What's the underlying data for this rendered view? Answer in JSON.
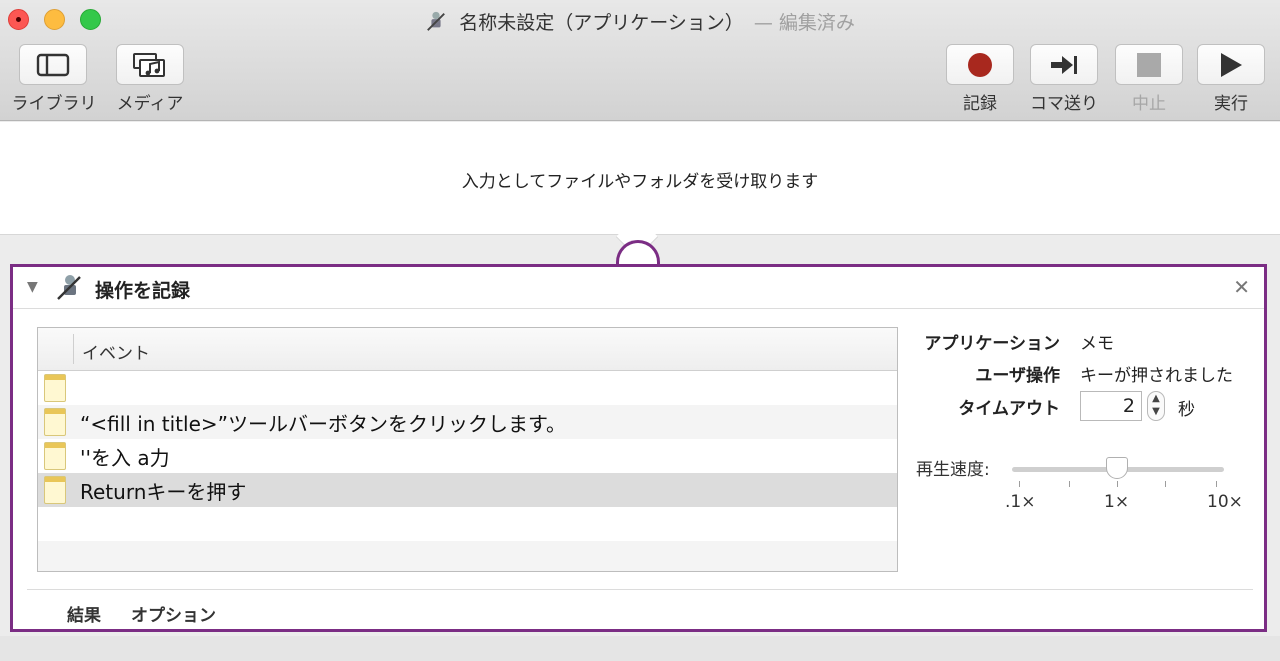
{
  "window": {
    "title": "名称未設定（アプリケーション）",
    "edited_label": "— 編集済み"
  },
  "toolbar": {
    "library_label": "ライブラリ",
    "media_label": "メディア",
    "record_label": "記録",
    "step_label": "コマ送り",
    "stop_label": "中止",
    "run_label": "実行"
  },
  "input_area": {
    "text": "入力としてファイルやフォルダを受け取ります"
  },
  "action": {
    "title": "操作を記録",
    "events_header": "イベント",
    "events": [
      {
        "text": ""
      },
      {
        "text": "“<fill in title>”ツールバーボタンをクリックします。"
      },
      {
        "text": "''を入 a力"
      },
      {
        "text": "Returnキーを押す"
      }
    ],
    "properties": {
      "application_label": "アプリケーション",
      "application_value": "メモ",
      "user_action_label": "ユーザ操作",
      "user_action_value": "キーが押されました",
      "timeout_label": "タイムアウト",
      "timeout_value": "2",
      "timeout_unit": "秒",
      "speed_label": "再生速度:",
      "speed_min": ".1×",
      "speed_mid": "1×",
      "speed_max": "10×",
      "speed_value": "1×"
    },
    "footer": {
      "results_tab": "結果",
      "options_tab": "オプション"
    }
  },
  "colors": {
    "accent": "#7b2d84",
    "record": "#a8281e"
  }
}
